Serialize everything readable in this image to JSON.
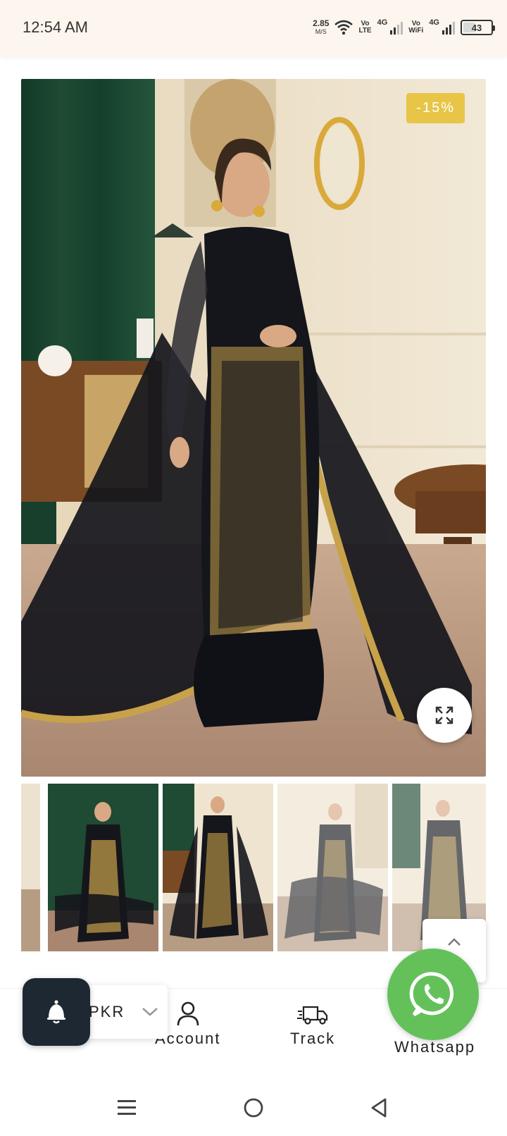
{
  "status_bar": {
    "time": "12:54 AM",
    "net_speed_value": "2.85",
    "net_speed_unit": "M/S",
    "volte1_top": "Vo",
    "volte1_bottom": "LTE",
    "sig1_label": "4G",
    "vowifi_top": "Vo",
    "vowifi_bottom": "WiFi",
    "sig2_label": "4G",
    "battery_level": "43"
  },
  "product": {
    "discount_badge": "-15%",
    "thumbnail_count": 5,
    "colors": {
      "badge": "#e8c547",
      "dress": "#15161c",
      "gold": "#c8a24a",
      "curtain": "#1f4a33",
      "wall": "#efe4cf"
    }
  },
  "bottom_nav": {
    "currency": "PKR",
    "items": [
      {
        "label": "Account",
        "icon": "user-icon"
      },
      {
        "label": "Track",
        "icon": "truck-icon"
      },
      {
        "label": "Whatsapp",
        "icon": "whatsapp-icon"
      }
    ]
  },
  "colors": {
    "whatsapp_green": "#64c15a",
    "notify_bg": "#1e2833",
    "status_bg": "#fdf6ee"
  },
  "system_nav": [
    "menu-icon",
    "home-icon",
    "back-icon"
  ]
}
